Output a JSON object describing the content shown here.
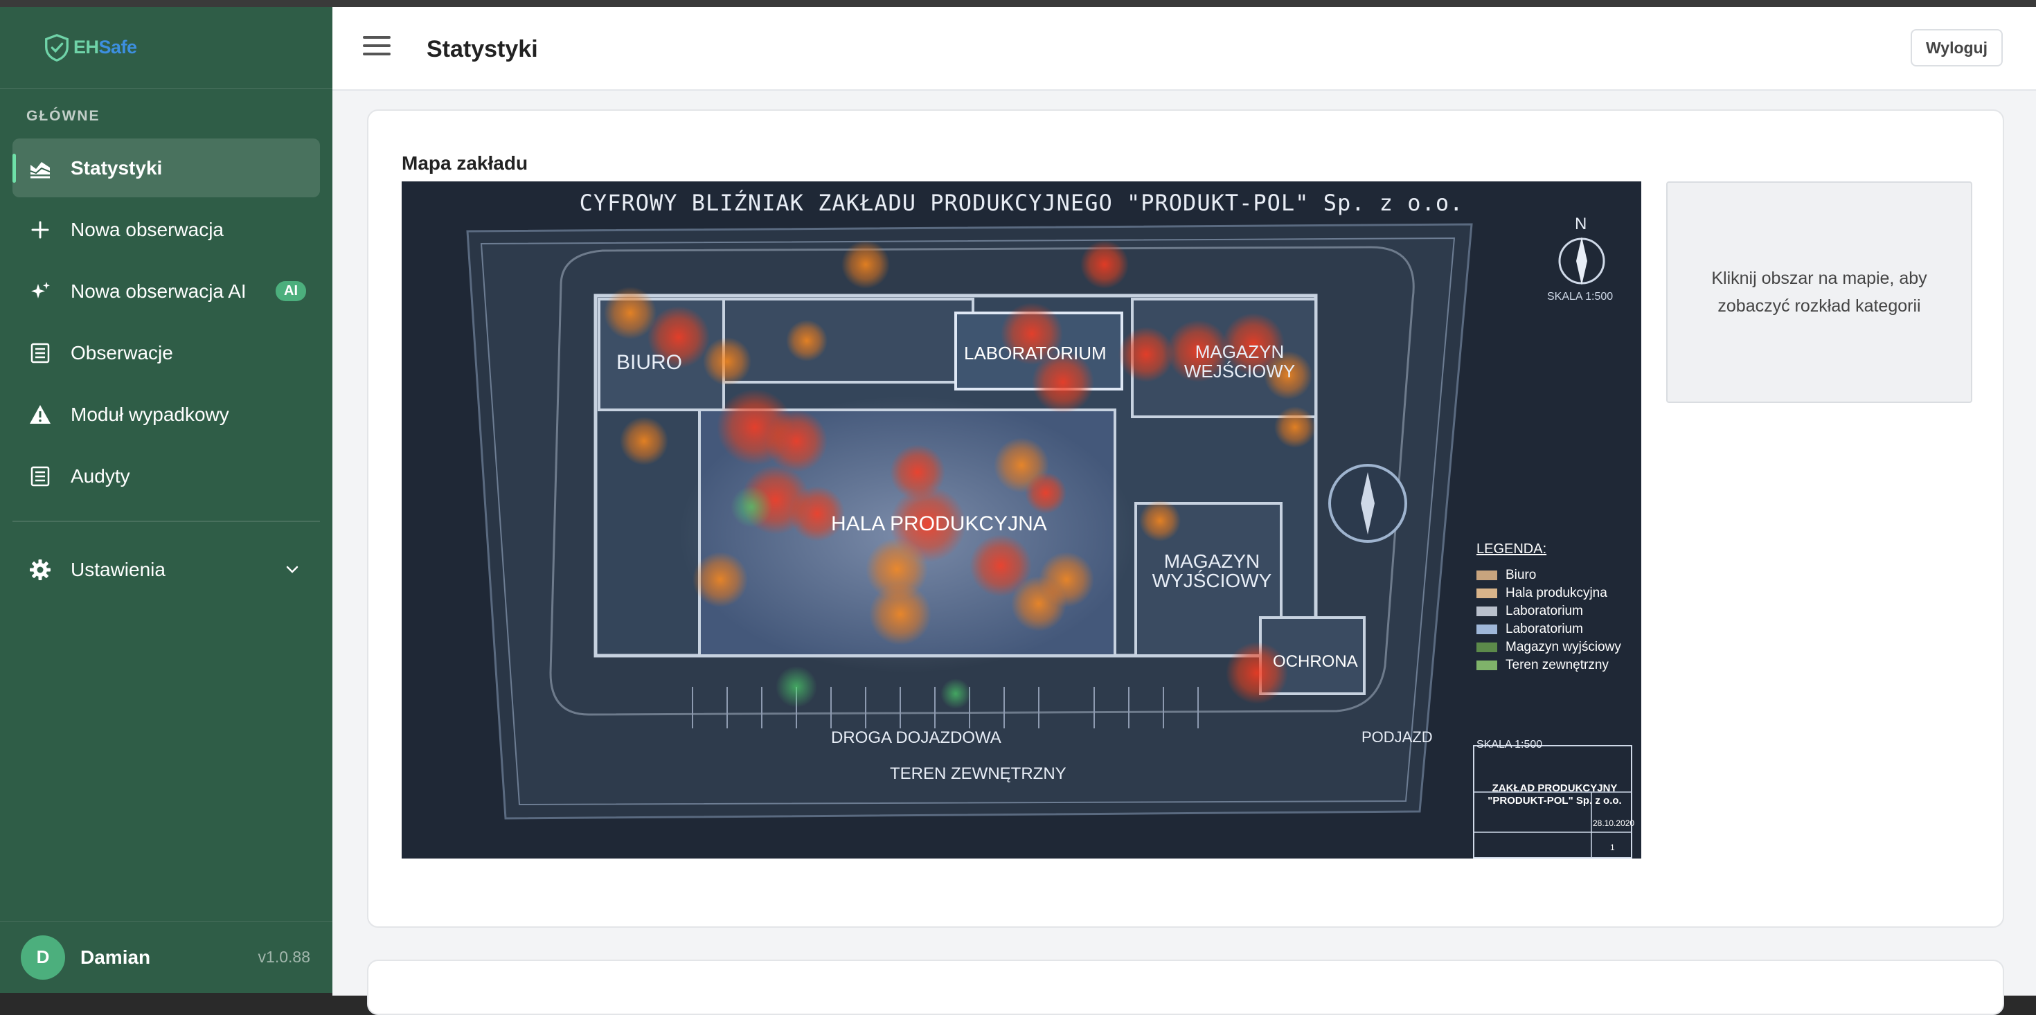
{
  "app": {
    "brand_prefix": "EH",
    "brand_suffix": "Safe",
    "version": "v1.0.88"
  },
  "sidebar": {
    "section_label": "GŁÓWNE",
    "items": [
      {
        "label": "Statystyki",
        "icon": "chart-area-icon",
        "active": true
      },
      {
        "label": "Nowa obserwacja",
        "icon": "plus-icon"
      },
      {
        "label": "Nowa obserwacja AI",
        "icon": "sparkles-icon",
        "badge": "AI"
      },
      {
        "label": "Obserwacje",
        "icon": "list-icon"
      },
      {
        "label": "Moduł wypadkowy",
        "icon": "warning-icon"
      },
      {
        "label": "Audyty",
        "icon": "list-icon"
      }
    ],
    "settings": {
      "label": "Ustawienia",
      "icon": "gear-icon"
    },
    "user": {
      "initial": "D",
      "name": "Damian"
    }
  },
  "header": {
    "title": "Statystyki",
    "logout_label": "Wyloguj"
  },
  "map_card": {
    "title": "Mapa zakładu",
    "hint": "Kliknij obszar na mapie, aby zobaczyć rozkład kategorii",
    "map": {
      "title": "CYFROWY BLIŹNIAK ZAKŁADU PRODUKCYJNEGO \"PRODUKT-POL\" Sp. z o.o.",
      "north": "N",
      "scale_top": "SKALA 1:500",
      "scale_bottom": "SKALA 1:500",
      "areas": {
        "biuro": "BIURO",
        "laboratorium": "LABORATORIUM",
        "magazyn_wej": "MAGAZYN WEJŚCIOWY",
        "hala": "HALA PRODUKCYJNA",
        "magazyn_wyj_1": "MAGAZYN",
        "magazyn_wyj_2": "WYJŚCIOWY",
        "ochrona": "OCHRONA",
        "droga": "DROGA DOJAZDOWA",
        "teren": "TEREN ZEWNĘTRZNY",
        "podjazd": "PODJAZD"
      },
      "legend_title": "LEGENDA:",
      "legend": [
        {
          "label": "Biuro",
          "color": "#c8a47e"
        },
        {
          "label": "Hala produkcyjna",
          "color": "#d9b48a"
        },
        {
          "label": "Laboratorium",
          "color": "#b9c0cc"
        },
        {
          "label": "Laboratorium",
          "color": "#9fb7d9"
        },
        {
          "label": "Magazyn wyjściowy",
          "color": "#5c8a4a"
        },
        {
          "label": "Teren zewnętrzny",
          "color": "#7fb36a"
        }
      ],
      "stamp_company": "ZAKŁAD PRODUKCYJNY \"PRODUKT-POL\" Sp. z o.o.",
      "stamp_date": "28.10.2020",
      "stamp_sheet": "1"
    }
  }
}
